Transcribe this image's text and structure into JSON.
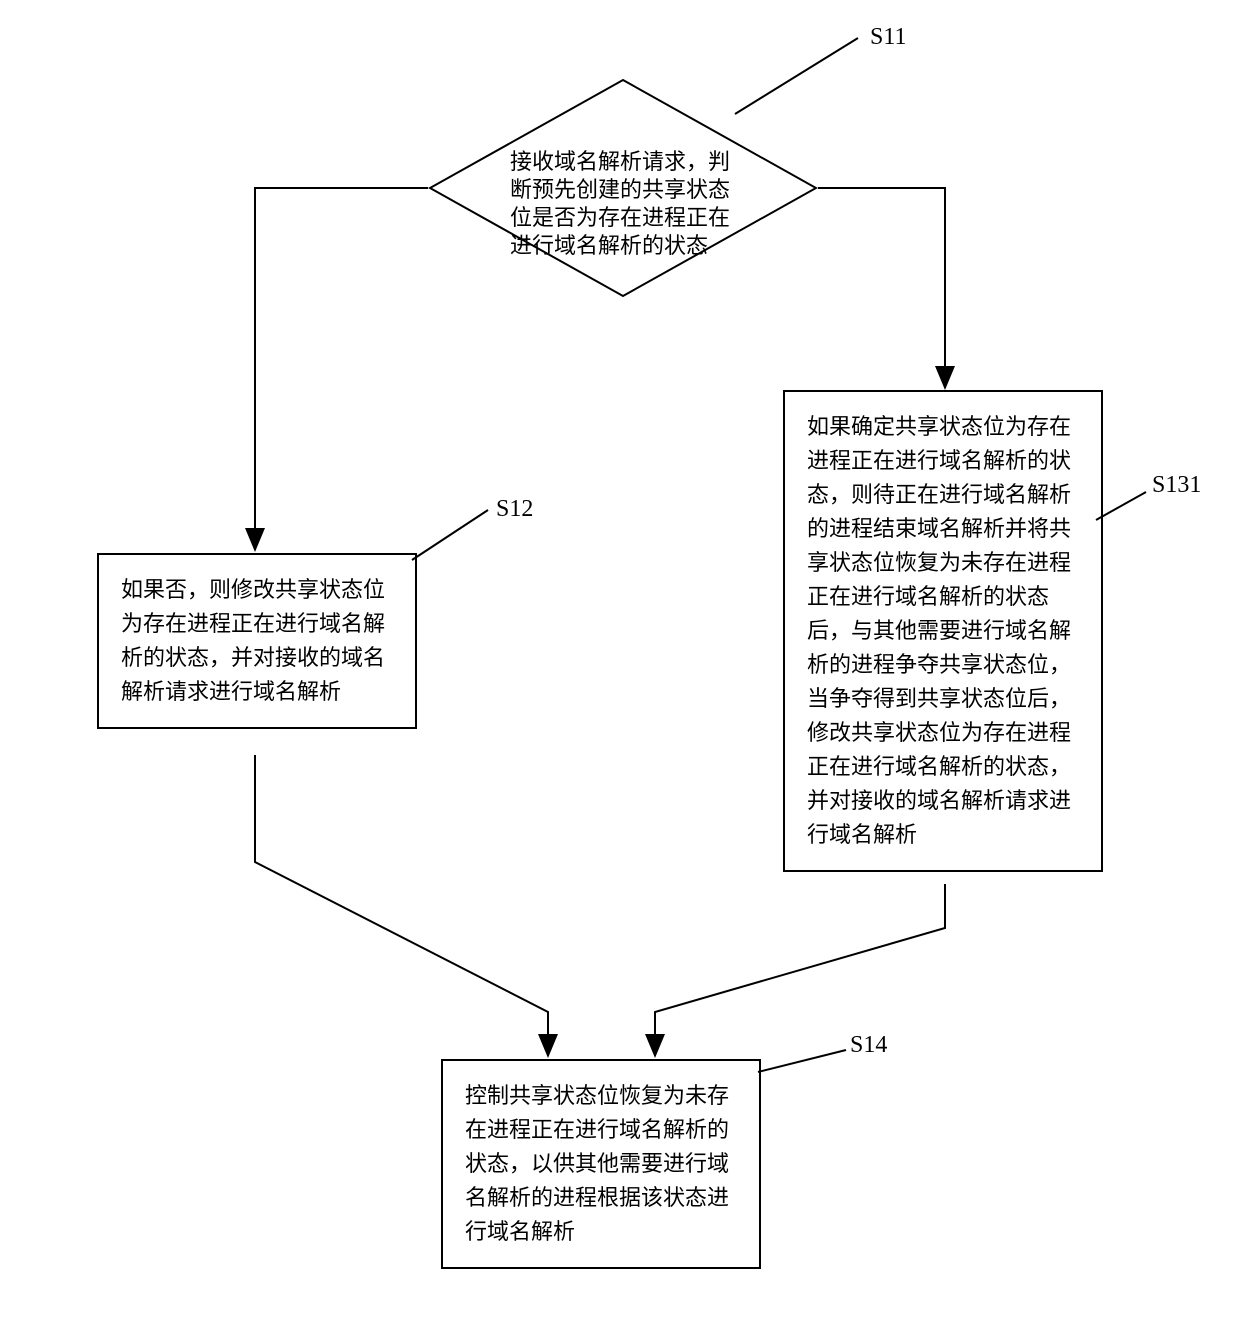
{
  "labels": {
    "s11": "S11",
    "s12": "S12",
    "s131": "S131",
    "s14": "S14"
  },
  "nodes": {
    "decision": "接收域名解析请求，判断预先创建的共享状态位是否为存在进程正在进行域名解析的状态",
    "s12": "如果否，则修改共享状态位为存在进程正在进行域名解析的状态，并对接收的域名解析请求进行域名解析",
    "s131": "如果确定共享状态位为存在进程正在进行域名解析的状态，则待正在进行域名解析的进程结束域名解析并将共享状态位恢复为未存在进程正在进行域名解析的状态后，与其他需要进行域名解析的进程争夺共享状态位，当争夺得到共享状态位后，修改共享状态位为存在进程正在进行域名解析的状态，并对接收的域名解析请求进行域名解析",
    "s14": "控制共享状态位恢复为未存在进程正在进行域名解析的状态，以供其他需要进行域名解析的进程根据该状态进行域名解析"
  }
}
